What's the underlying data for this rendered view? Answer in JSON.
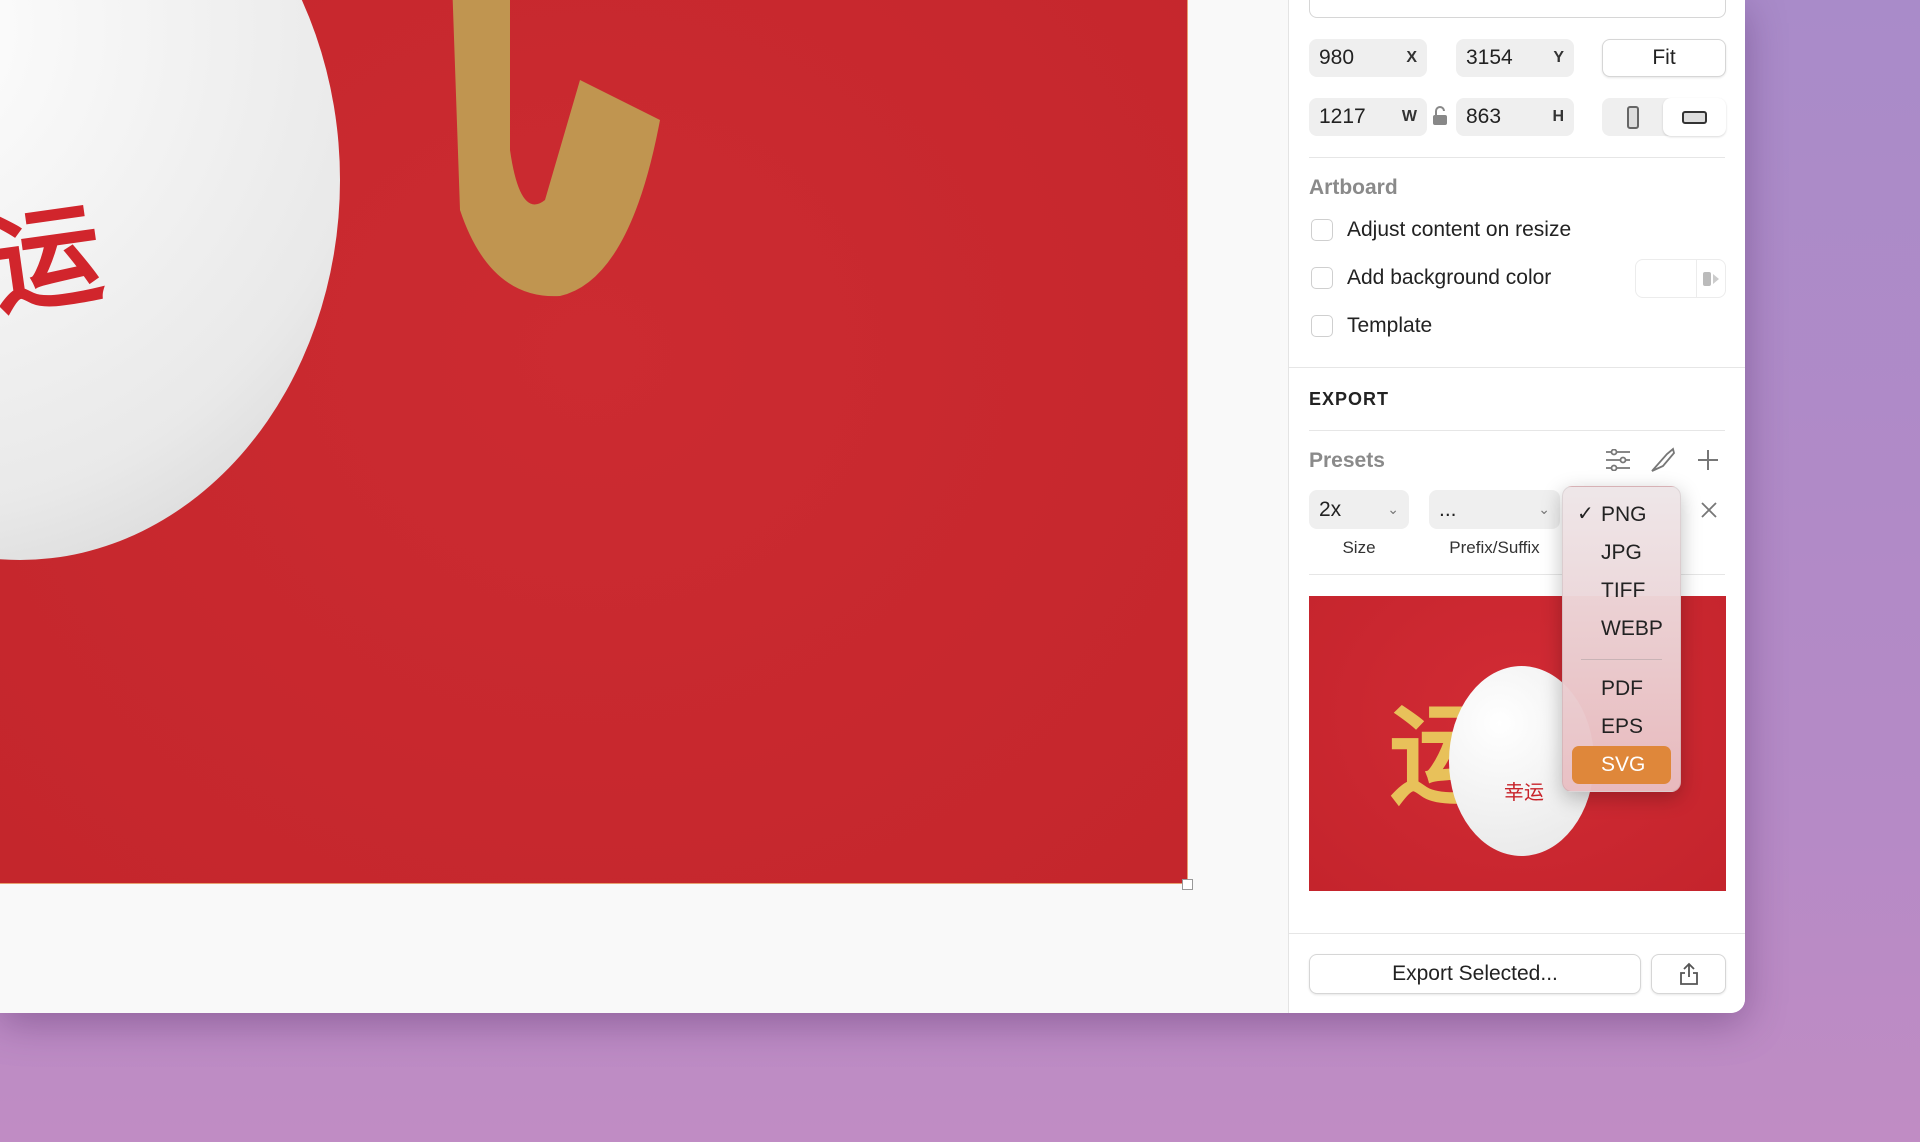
{
  "geometry": {
    "x": "980",
    "x_label": "X",
    "y": "3154",
    "y_label": "Y",
    "fit_label": "Fit",
    "w": "1217",
    "w_label": "W",
    "h": "863",
    "h_label": "H"
  },
  "artboard": {
    "title": "Artboard",
    "options": [
      {
        "label": "Adjust content on resize",
        "checked": false
      },
      {
        "label": "Add background color",
        "checked": false
      },
      {
        "label": "Template",
        "checked": false
      }
    ]
  },
  "canvas": {
    "artwork_text": "运"
  },
  "export": {
    "title": "EXPORT",
    "presets_label": "Presets",
    "size_value": "2x",
    "size_label": "Size",
    "prefix_value": "...",
    "prefix_label": "Prefix/Suffix",
    "preview_text": "幸运",
    "export_button": "Export Selected..."
  },
  "format_menu": {
    "items": [
      "PNG",
      "JPG",
      "TIFF",
      "WEBP",
      "PDF",
      "EPS",
      "SVG"
    ],
    "checked": "PNG",
    "highlighted": "SVG",
    "highlight_color": "#df873a"
  }
}
